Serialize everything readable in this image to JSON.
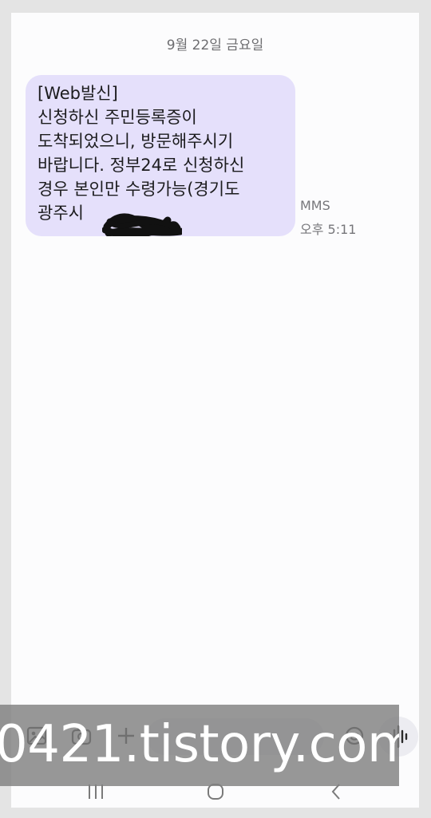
{
  "conversation": {
    "date_header": "9월 22일 금요일",
    "message": {
      "lines": [
        "[Web발신]",
        "신청하신 주민등록증이",
        "도착되었으니, 방문해주시기",
        "바랍니다. 정부24로 신청하신",
        "경우 본인만 수령가능(경기도",
        "광주시"
      ],
      "type_label": "MMS",
      "time": "오후 5:11",
      "bubble_color": "#e5e0fb"
    }
  },
  "composer": {
    "icons": [
      "gallery-icon",
      "camera-icon",
      "plus-icon",
      "emoji-icon",
      "voice-icon"
    ]
  },
  "navbar": {
    "icons": [
      "recent-apps-icon",
      "home-icon",
      "back-icon"
    ]
  },
  "watermark": {
    "text": "0421.tistory.com"
  }
}
